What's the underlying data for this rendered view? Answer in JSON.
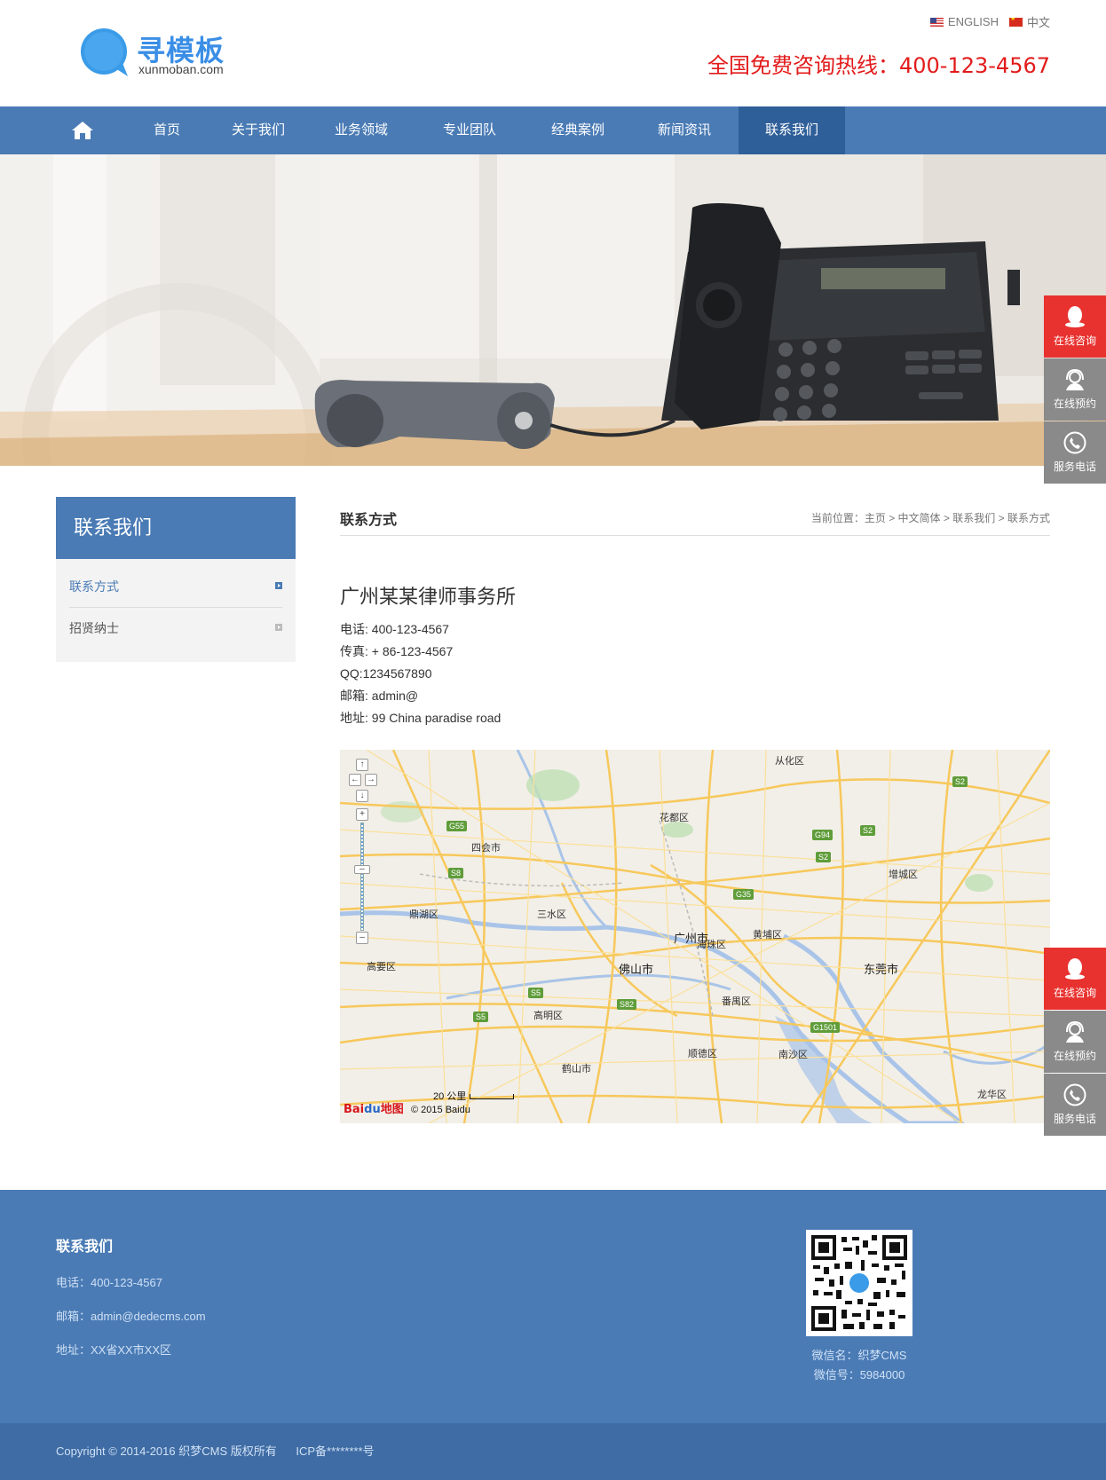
{
  "header": {
    "logo_name": "寻模板",
    "logo_url": "xunmoban.com",
    "lang_en": "ENGLISH",
    "lang_cn": "中文",
    "hotline": "全国免费咨询热线：400-123-4567"
  },
  "nav": {
    "items": [
      "首页",
      "关于我们",
      "业务领域",
      "专业团队",
      "经典案例",
      "新闻资讯",
      "联系我们"
    ],
    "active": "联系我们"
  },
  "float_buttons": {
    "consult": "在线咨询",
    "booking": "在线预约",
    "phone": "服务电话"
  },
  "sidebar": {
    "title": "联系我们",
    "items": [
      {
        "label": "联系方式",
        "active": true
      },
      {
        "label": "招贤纳士",
        "active": false
      }
    ]
  },
  "main": {
    "title": "联系方式",
    "breadcrumb": {
      "prefix": "当前位置：",
      "items": [
        "主页",
        "中文简体",
        "联系我们",
        "联系方式"
      ],
      "separator": ">"
    },
    "company": "广州某某律师事务所",
    "phone": "电话: 400-123-4567",
    "fax": "传真: + 86-123-4567",
    "qq": "QQ:1234567890",
    "email": "邮箱: admin@",
    "address": "地址: 99 China paradise road"
  },
  "map": {
    "labels": {
      "conghua": "从化区",
      "huadu": "花都区",
      "sihui": "四会市",
      "zengcheng": "增城区",
      "dinghu": "鼎湖区",
      "sanshui": "三水区",
      "guangzhou": "广州市",
      "huangpu": "黄埔区",
      "haizhu": "海珠区",
      "gaoyao": "高要区",
      "foshan": "佛山市",
      "dongguan": "东莞市",
      "panyu": "番禺区",
      "gaoming": "高明区",
      "shunde": "顺德区",
      "nansha": "南沙区",
      "heshan": "鹤山市",
      "longhua": "龙华区"
    },
    "shields": {
      "g55": "G55",
      "s8": "S8",
      "g94": "G94",
      "s2a": "S2",
      "s2b": "S2",
      "s2c": "S2",
      "g35": "G35",
      "s5a": "S5",
      "s5b": "S5",
      "s82": "S82",
      "g1501": "G1501"
    },
    "scale": "20 公里",
    "copyright": "© 2015 Baidu",
    "logo_a": "Bai",
    "logo_b": "du",
    "logo_c": "地图"
  },
  "footer": {
    "title": "联系我们",
    "phone": "电话：400-123-4567",
    "email": "邮箱：admin@dedecms.com",
    "address": "地址：XX省XX市XX区",
    "wechat_name": "微信名：织梦CMS",
    "wechat_id": "微信号：5984000",
    "copyright": "Copyright © 2014-2016 织梦CMS 版权所有",
    "icp": "ICP备********号"
  },
  "colors": {
    "primary": "#4a7bb5",
    "nav_active": "#2f5f99",
    "hotline": "#e21b1b",
    "float_red": "#e8322f",
    "float_gray": "#8a8a8a"
  }
}
